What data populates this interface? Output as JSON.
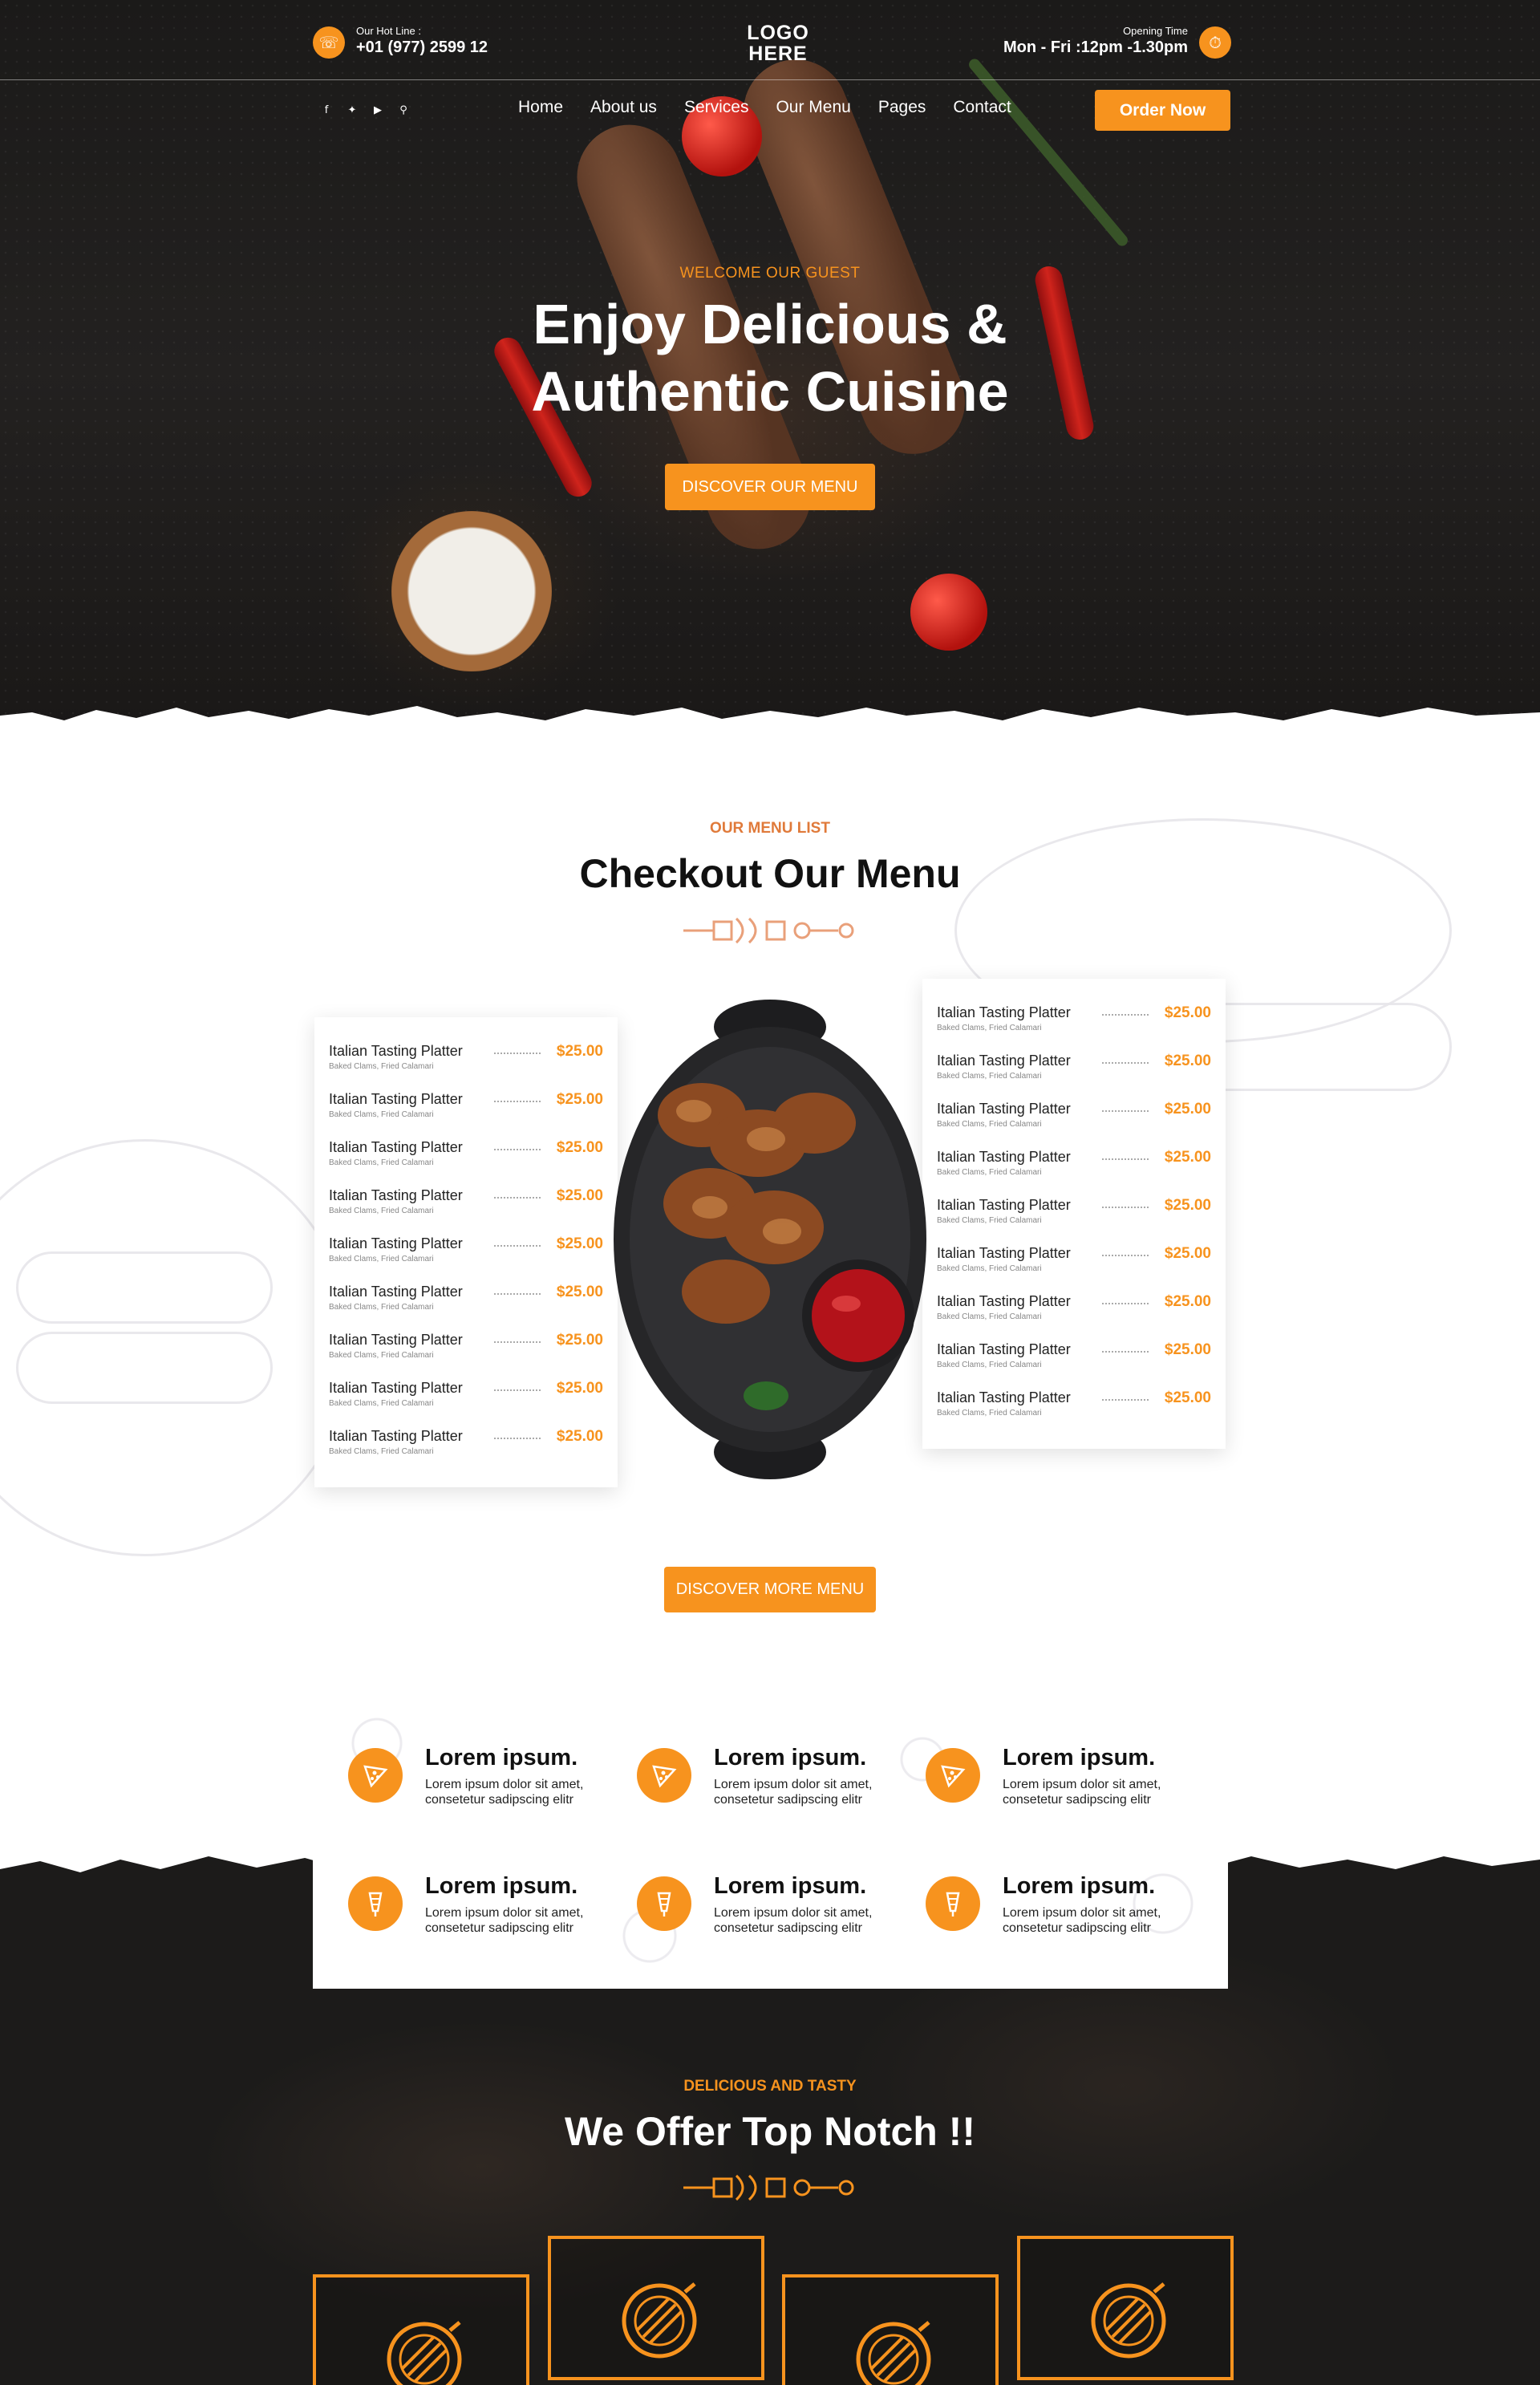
{
  "header": {
    "hotline_label": "Our Hot Line :",
    "hotline_number": "+01 (977) 2599 12",
    "logo_line1": "LOGO",
    "logo_line2": "HERE",
    "opening_label": "Opening Time",
    "opening_hours": "Mon - Fri :12pm -1.30pm"
  },
  "nav": {
    "items": [
      {
        "label": "Home"
      },
      {
        "label": "About us"
      },
      {
        "label": "Services"
      },
      {
        "label": "Our Menu"
      },
      {
        "label": "Pages"
      },
      {
        "label": "Contact"
      }
    ],
    "order_button": "Order Now",
    "social_icons": [
      "facebook-icon",
      "twitter-icon",
      "youtube-icon",
      "search-icon"
    ]
  },
  "hero": {
    "kicker": "WELCOME OUR GUEST",
    "title_line1": "Enjoy Delicious &",
    "title_line2": "Authentic Cuisine",
    "button": "DISCOVER OUR MENU"
  },
  "menu": {
    "kicker": "OUR MENU LIST",
    "title": "Checkout Our Menu",
    "left_items": [
      {
        "name": "Italian Tasting Platter",
        "desc": "Baked Clams, Fried Calamari",
        "price": "$25.00"
      },
      {
        "name": "Italian Tasting Platter",
        "desc": "Baked Clams, Fried Calamari",
        "price": "$25.00"
      },
      {
        "name": "Italian Tasting Platter",
        "desc": "Baked Clams, Fried Calamari",
        "price": "$25.00"
      },
      {
        "name": "Italian Tasting Platter",
        "desc": "Baked Clams, Fried Calamari",
        "price": "$25.00"
      },
      {
        "name": "Italian Tasting Platter",
        "desc": "Baked Clams, Fried Calamari",
        "price": "$25.00"
      },
      {
        "name": "Italian Tasting Platter",
        "desc": "Baked Clams, Fried Calamari",
        "price": "$25.00"
      },
      {
        "name": "Italian Tasting Platter",
        "desc": "Baked Clams, Fried Calamari",
        "price": "$25.00"
      },
      {
        "name": "Italian Tasting Platter",
        "desc": "Baked Clams, Fried Calamari",
        "price": "$25.00"
      },
      {
        "name": "Italian Tasting Platter",
        "desc": "Baked Clams, Fried Calamari",
        "price": "$25.00"
      }
    ],
    "right_items": [
      {
        "name": "Italian Tasting Platter",
        "desc": "Baked Clams, Fried Calamari",
        "price": "$25.00"
      },
      {
        "name": "Italian Tasting Platter",
        "desc": "Baked Clams, Fried Calamari",
        "price": "$25.00"
      },
      {
        "name": "Italian Tasting Platter",
        "desc": "Baked Clams, Fried Calamari",
        "price": "$25.00"
      },
      {
        "name": "Italian Tasting Platter",
        "desc": "Baked Clams, Fried Calamari",
        "price": "$25.00"
      },
      {
        "name": "Italian Tasting Platter",
        "desc": "Baked Clams, Fried Calamari",
        "price": "$25.00"
      },
      {
        "name": "Italian Tasting Platter",
        "desc": "Baked Clams, Fried Calamari",
        "price": "$25.00"
      },
      {
        "name": "Italian Tasting Platter",
        "desc": "Baked Clams, Fried Calamari",
        "price": "$25.00"
      },
      {
        "name": "Italian Tasting Platter",
        "desc": "Baked Clams, Fried Calamari",
        "price": "$25.00"
      },
      {
        "name": "Italian Tasting Platter",
        "desc": "Baked Clams, Fried Calamari",
        "price": "$25.00"
      }
    ],
    "more_button": "DISCOVER MORE MENU"
  },
  "features": [
    {
      "title": "Lorem ipsum.",
      "text": "Lorem ipsum dolor sit amet, consetetur sadipscing elitr",
      "icon": "pizza-slice-icon"
    },
    {
      "title": "Lorem ipsum.",
      "text": "Lorem ipsum dolor sit amet, consetetur sadipscing elitr",
      "icon": "pizza-slice-icon"
    },
    {
      "title": "Lorem ipsum.",
      "text": "Lorem ipsum dolor sit amet, consetetur sadipscing elitr",
      "icon": "pizza-slice-icon"
    },
    {
      "title": "Lorem ipsum.",
      "text": "Lorem ipsum dolor sit amet, consetetur sadipscing elitr",
      "icon": "kebab-icon"
    },
    {
      "title": "Lorem ipsum.",
      "text": "Lorem ipsum dolor sit amet, consetetur sadipscing elitr",
      "icon": "kebab-icon"
    },
    {
      "title": "Lorem ipsum.",
      "text": "Lorem ipsum dolor sit amet, consetetur sadipscing elitr",
      "icon": "kebab-icon"
    }
  ],
  "offer": {
    "kicker": "DELICIOUS AND TASTY",
    "title": "We Offer Top Notch !!",
    "card_icons": [
      "grill-plate-icon",
      "grill-plate-icon",
      "grill-plate-icon",
      "grill-plate-icon"
    ]
  },
  "colors": {
    "accent": "#f7931e",
    "dark_bg": "#1c1b1a",
    "menu_kicker": "#e07a3a"
  }
}
